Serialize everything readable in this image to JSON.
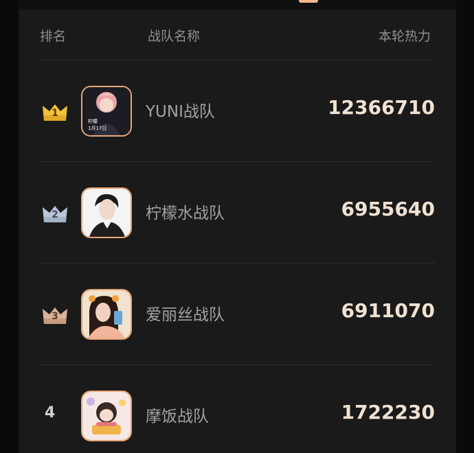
{
  "header": {
    "rank_label": "排名",
    "team_label": "战队名称",
    "heat_label": "本轮热力"
  },
  "rows": [
    {
      "rank": "1",
      "team": "YUNI战队",
      "heat": "12366710",
      "crown": "gold",
      "avatar_caption_1": "柠檬",
      "avatar_caption_2": "1月17日"
    },
    {
      "rank": "2",
      "team": "柠檬水战队",
      "heat": "6955640",
      "crown": "silver"
    },
    {
      "rank": "3",
      "team": "爱丽丝战队",
      "heat": "6911070",
      "crown": "bronze"
    },
    {
      "rank": "4",
      "team": "摩饭战队",
      "heat": "1722230",
      "crown": "none"
    }
  ],
  "colors": {
    "gold": "#f2c23a",
    "silver": "#b9c7d8",
    "bronze": "#d9b39a",
    "accent": "#e8a777"
  }
}
